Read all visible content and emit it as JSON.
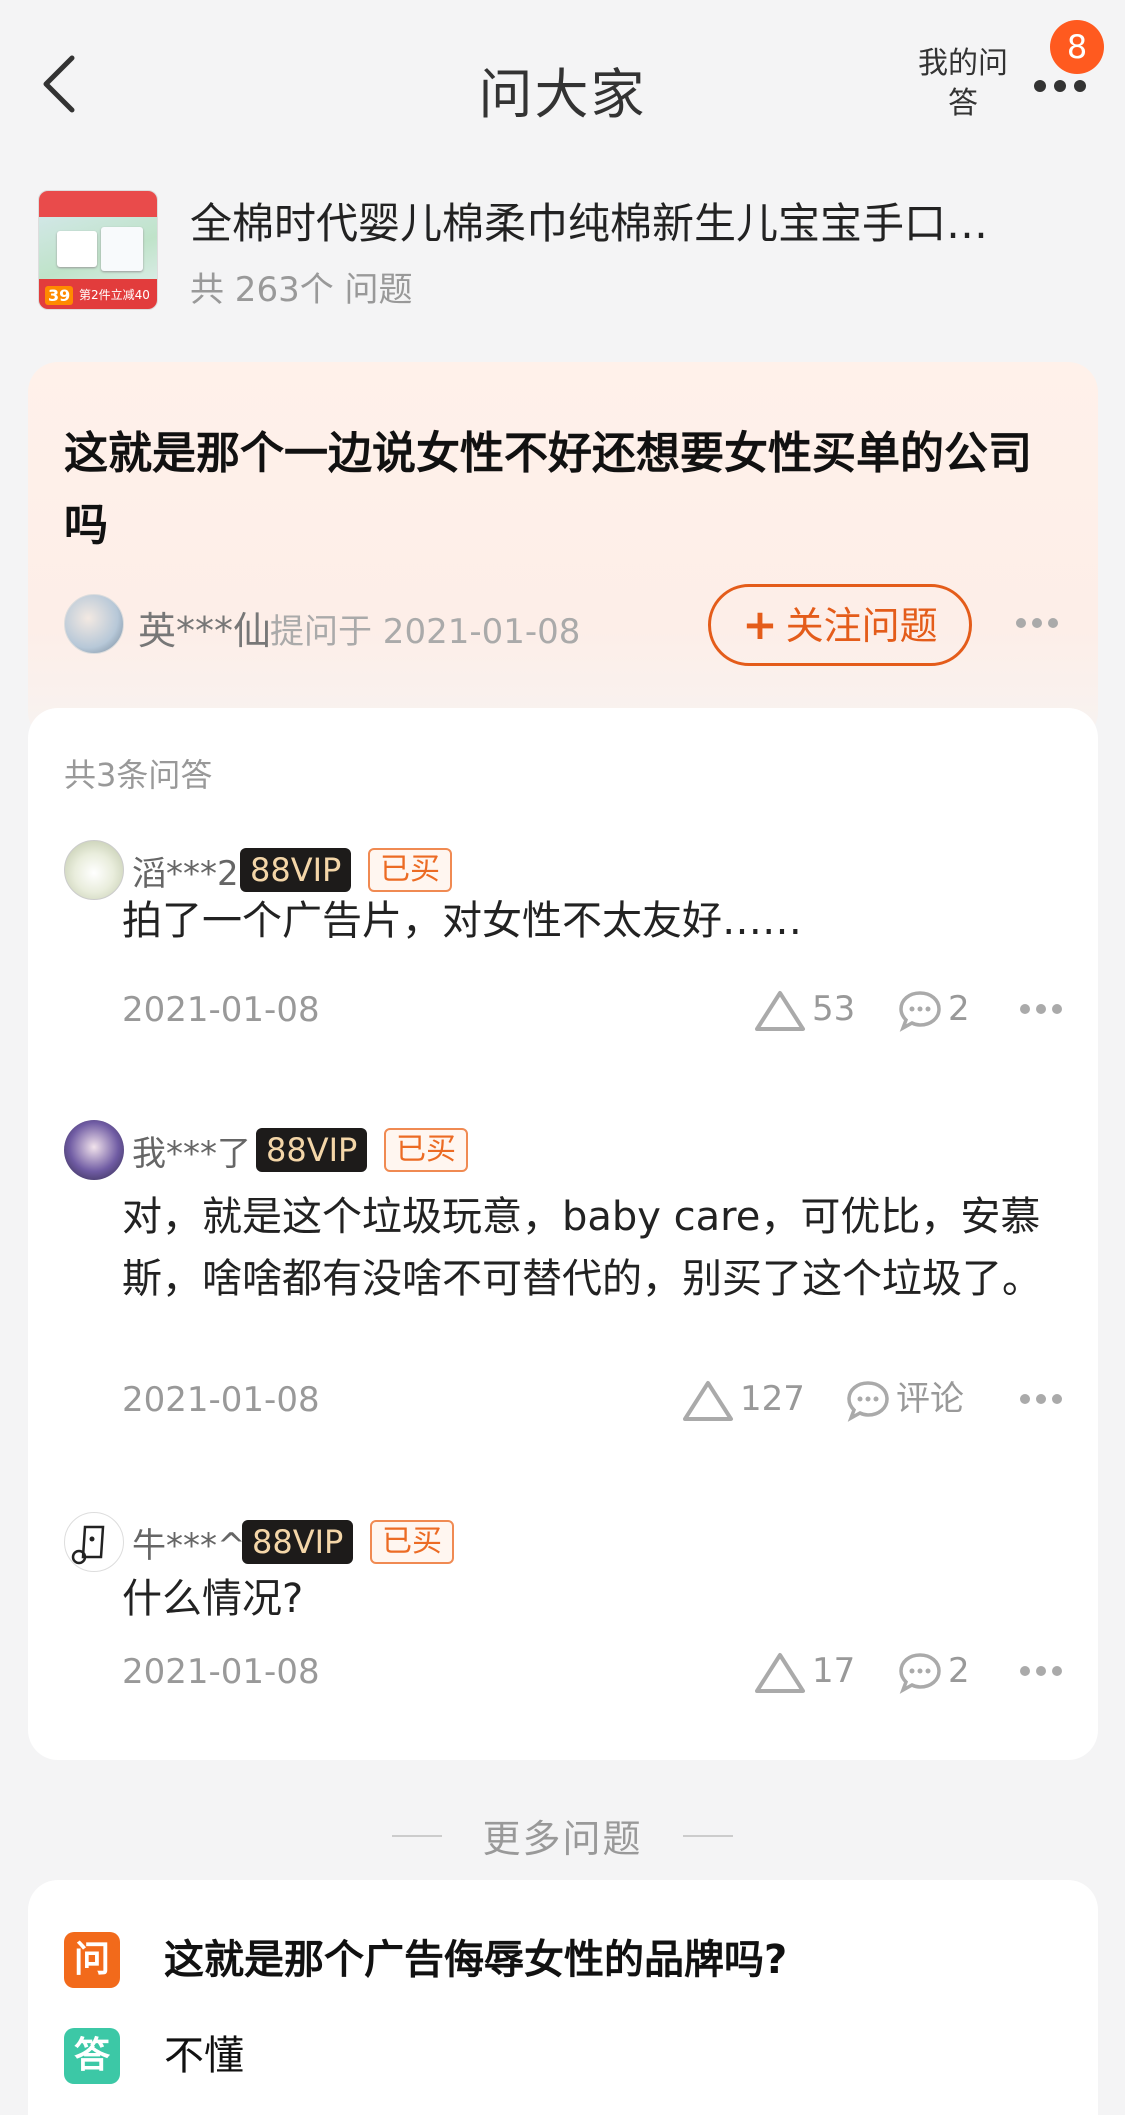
{
  "header": {
    "title": "问大家",
    "my_answers": "我的问答",
    "badge_count": "8"
  },
  "product": {
    "name": "全棉时代婴儿棉柔巾纯棉新生儿宝宝手口…",
    "count": "共 263个 问题",
    "thumb_price": "39",
    "thumb_promo": "第2件立减40"
  },
  "question": {
    "title": "这就是那个一边说女性不好还想要女性买单的公司吗",
    "user": "英***仙",
    "asked": "提问于 2021-01-08",
    "follow_label": "关注问题"
  },
  "answers_section": {
    "count_label": "共3条问答",
    "items": [
      {
        "user": "滔***2",
        "vip": "88VIP",
        "bought": "已买",
        "text": "拍了一个广告片，对女性不太友好……",
        "date": "2021-01-08",
        "likes": "53",
        "comments": "2"
      },
      {
        "user": "我***了",
        "vip": "88VIP",
        "bought": "已买",
        "text": "对，就是这个垃圾玩意，baby care，可优比，安慕斯，啥啥都有没啥不可替代的，别买了这个垃圾了。",
        "date": "2021-01-08",
        "likes": "127",
        "comments": "评论"
      },
      {
        "user": "牛***^",
        "vip": "88VIP",
        "bought": "已买",
        "text": "什么情况?",
        "date": "2021-01-08",
        "likes": "17",
        "comments": "2"
      }
    ]
  },
  "more_questions": {
    "label": "更多问题",
    "items": [
      {
        "tag": "问",
        "text": "这就是那个广告侮辱女性的品牌吗?"
      },
      {
        "tag": "答",
        "text": "不懂"
      }
    ]
  },
  "colors": {
    "accent": "#e45c1a",
    "badge": "#ff5a1f",
    "vip_bg": "#1d1b1a",
    "vip_text": "#f4d6a8",
    "answer_tag": "#3cc8a6"
  },
  "icons": [
    "back-arrow-icon",
    "more-dots-icon",
    "plus-icon",
    "like-triangle-icon",
    "comment-bubble-icon"
  ]
}
